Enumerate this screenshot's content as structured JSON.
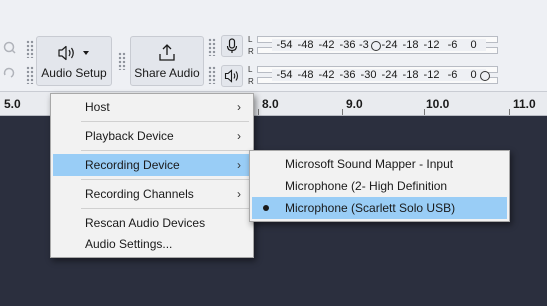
{
  "toolbar": {
    "audio_setup_label": "Audio Setup",
    "share_audio_label": "Share Audio"
  },
  "meters": {
    "left_label": "L",
    "right_label": "R",
    "recording_scale": [
      "-54",
      "-48",
      "-42",
      "-36",
      "-3",
      "-24",
      "-18",
      "-12",
      "-6",
      "0"
    ],
    "playback_scale": [
      "-54",
      "-48",
      "-42",
      "-36",
      "-30",
      "-24",
      "-18",
      "-12",
      "-6",
      "0"
    ]
  },
  "ruler": {
    "labels": [
      "5.0",
      "8.0",
      "9.0",
      "10.0",
      "11.0"
    ]
  },
  "menu": {
    "items": [
      {
        "label": "Host",
        "arrow": "›"
      },
      {
        "label": "Playback Device",
        "arrow": "›"
      },
      {
        "label": "Recording Device",
        "arrow": "›"
      },
      {
        "label": "Recording Channels",
        "arrow": "›"
      },
      {
        "label": "Rescan Audio Devices"
      },
      {
        "label": "Audio Settings..."
      }
    ]
  },
  "submenu": {
    "items": [
      {
        "label": "Microsoft Sound Mapper - Input"
      },
      {
        "label": "Microphone (2- High Definition"
      },
      {
        "label": "Microphone (Scarlett Solo USB)"
      }
    ],
    "selected_index": 2
  },
  "colors": {
    "highlight": "#99cdf6",
    "background": "#2b2f3e",
    "toolbar": "#eef0f4"
  }
}
